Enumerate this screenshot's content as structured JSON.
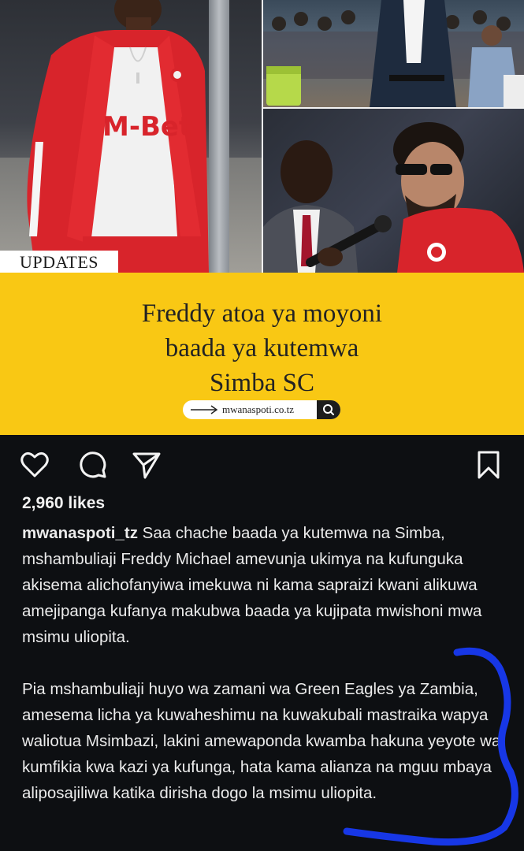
{
  "post_image": {
    "tag": "UPDATES",
    "headline_lines": [
      "Freddy atoa ya moyoni",
      "baada ya kutemwa",
      "Simba SC"
    ],
    "source_domain": "mwanaspoti.co.tz",
    "jersey_sponsor": "M-Bet"
  },
  "actions": {
    "like_icon": "heart-icon",
    "comment_icon": "comment-icon",
    "share_icon": "send-icon",
    "save_icon": "bookmark-icon"
  },
  "likes": "2,960 likes",
  "caption": {
    "username": "mwanaspoti_tz",
    "paragraph1": "Saa chache baada ya kutemwa na Simba, mshambuliaji Freddy Michael amevunja ukimya na kufunguka akisema alichofanyiwa imekuwa ni kama sapraizi kwani alikuwa amejipanga kufanya makubwa baada ya kujipata mwishoni mwa msimu uliopita.",
    "paragraph2": "Pia mshambuliaji huyo wa zamani wa Green Eagles ya Zambia, amesema licha ya kuwaheshimu na kuwakubali mastraika wapya waliotua Msimbazi, lakini amewaponda kwamba hakuna yeyote wa kumfikia kwa kazi ya kufunga, hata kama alianza na mguu mbaya aliposajiliwa katika dirisha dogo la msimu uliopita."
  },
  "colors": {
    "headline_band": "#f9c814",
    "background": "#0d0f12",
    "annotation_scribble": "#1737e6",
    "jersey_red": "#d8242b"
  }
}
